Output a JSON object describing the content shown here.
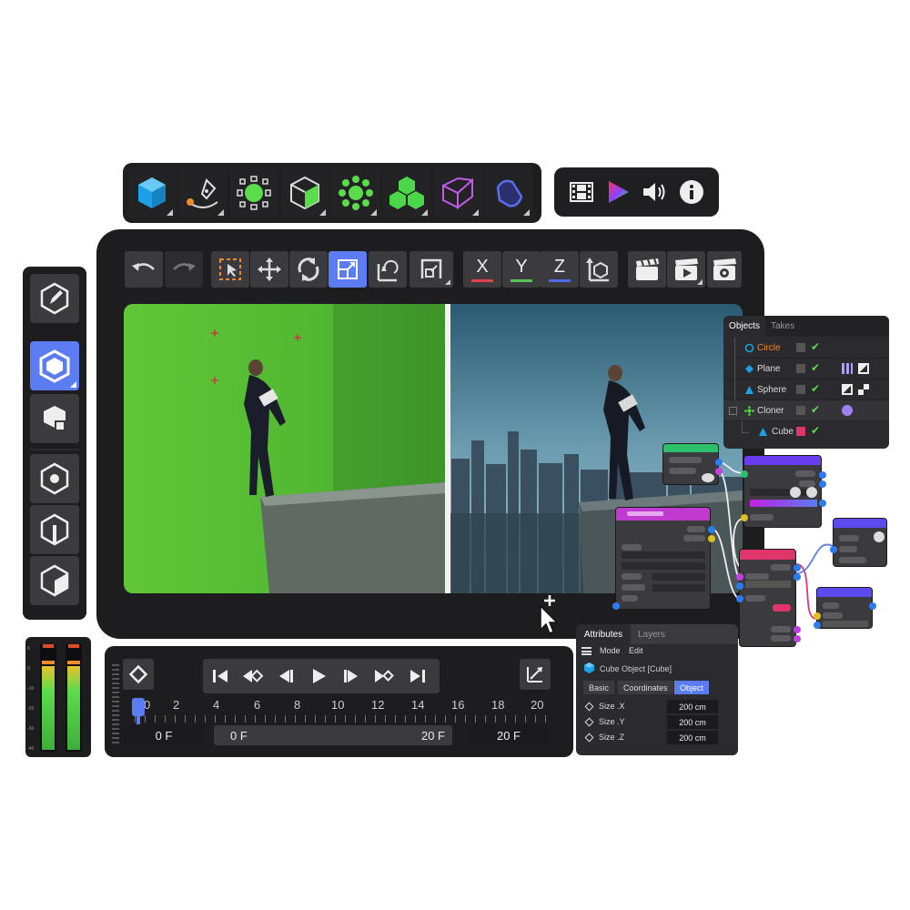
{
  "top_toolbar": {
    "items": [
      {
        "name": "cube-icon",
        "color": "#1ea0e6"
      },
      {
        "name": "pen-spline-icon",
        "color": "#f08a2a"
      },
      {
        "name": "sphere-points-icon",
        "color": "#5bdc4a"
      },
      {
        "name": "box-generator-icon",
        "color": "#5bdc4a"
      },
      {
        "name": "cloner-icon",
        "color": "#5bdc4a"
      },
      {
        "name": "volume-blocks-icon",
        "color": "#4cd64a"
      },
      {
        "name": "deformer-icon",
        "color": "#c25ce6"
      },
      {
        "name": "nurbs-icon",
        "color": "#5a6ef0"
      }
    ]
  },
  "media_toolbar": {
    "items": [
      "film-icon",
      "color-triangle-icon",
      "speaker-icon",
      "info-icon"
    ]
  },
  "viewport_toolbar": {
    "axis_x": "X",
    "axis_y": "Y",
    "axis_z": "Z",
    "colors": {
      "x": "#e0434a",
      "y": "#56c45a",
      "z": "#4d6be6",
      "active": "#5b7cf2"
    }
  },
  "objects_panel": {
    "tabs": [
      "Objects",
      "Takes"
    ],
    "items": [
      {
        "label": "Circle",
        "color": "#f08a2a"
      },
      {
        "label": "Plane",
        "color": "#dddddd"
      },
      {
        "label": "Sphere",
        "color": "#dddddd"
      },
      {
        "label": "Cloner",
        "color": "#dddddd"
      },
      {
        "label": "Cube",
        "color": "#dddddd"
      }
    ]
  },
  "attributes_panel": {
    "tabs": [
      "Attributes",
      "Layers"
    ],
    "menu": [
      "Mode",
      "Edit"
    ],
    "object_title": "Cube Object [Cube]",
    "subtabs": [
      "Basic",
      "Coordinates",
      "Object"
    ],
    "fields": [
      {
        "label": "Size .X",
        "value": "200 cm"
      },
      {
        "label": "Size .Y",
        "value": "200 cm"
      },
      {
        "label": "Size .Z",
        "value": "200 cm"
      }
    ]
  },
  "timeline": {
    "ticks": [
      "0",
      "2",
      "4",
      "6",
      "8",
      "10",
      "12",
      "14",
      "16",
      "18",
      "20"
    ],
    "current_frame": "0 F",
    "range_start": "0 F",
    "range_end": "20 F",
    "end_frame": "20 F"
  },
  "level_meter": {
    "scale": [
      "6",
      "0",
      "-10",
      "-20",
      "-30",
      "-40"
    ]
  }
}
